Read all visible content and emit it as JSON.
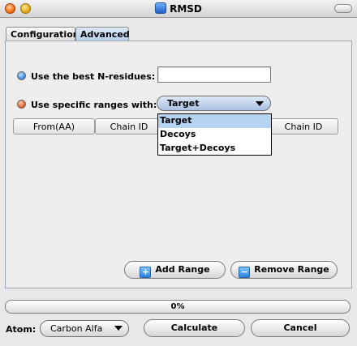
{
  "window": {
    "title": "RMSD"
  },
  "tabs": [
    {
      "label": "Configuration"
    },
    {
      "label": "Advanced"
    }
  ],
  "options": {
    "best_n_label": "Use the best N-residues:",
    "best_n_value": "",
    "specific_ranges_label": "Use specific ranges with:",
    "range_target_selected": "Target",
    "dropdown_items": [
      "Target",
      "Decoys",
      "Target+Decoys"
    ]
  },
  "table": {
    "headers": [
      "From(AA)",
      "Chain ID",
      "Chain ID"
    ]
  },
  "buttons": {
    "add_range": "Add Range",
    "remove_range": "Remove Range",
    "calculate": "Calculate",
    "cancel": "Cancel"
  },
  "progress": {
    "label": "0%",
    "value": 0
  },
  "atom": {
    "label": "Atom:",
    "selected": "Carbon Alfa"
  },
  "colors": {
    "accent_blue": "#2d86e6",
    "accent_orange": "#e0561b",
    "selection": "#b7d3f3"
  },
  "icons": {
    "app": "molecule-icon",
    "add": "plus-icon",
    "remove": "minus-icon"
  }
}
